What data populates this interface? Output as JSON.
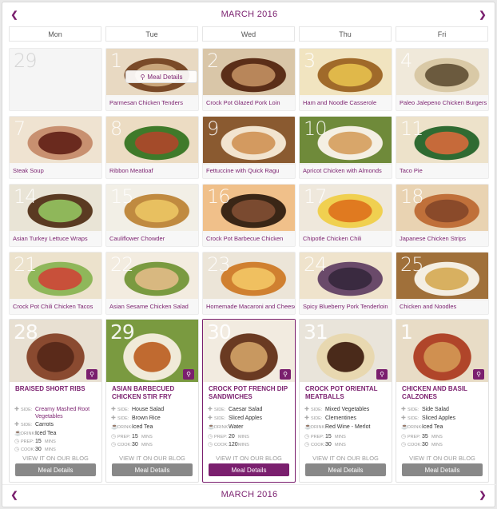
{
  "calendar": {
    "month": "MARCH 2016",
    "prev_icon": "chevron-left-icon",
    "next_icon": "chevron-right-icon",
    "weekdays": [
      "Mon",
      "Tue",
      "Wed",
      "Thu",
      "Fri"
    ]
  },
  "grid": [
    [
      {
        "day": "29",
        "title": "",
        "empty": true
      },
      {
        "day": "1",
        "title": "Parmesan Chicken Tenders",
        "popup": "Meal Details"
      },
      {
        "day": "2",
        "title": "Crock Pot Glazed Pork Loin"
      },
      {
        "day": "3",
        "title": "Ham and Noodle Casserole"
      },
      {
        "day": "4",
        "title": "Paleo Jalepeno Chicken Burgers"
      }
    ],
    [
      {
        "day": "7",
        "title": "Steak Soup"
      },
      {
        "day": "8",
        "title": "Ribbon Meatloaf"
      },
      {
        "day": "9",
        "title": "Fettuccine with Quick Ragu"
      },
      {
        "day": "10",
        "title": "Apricot Chicken with Almonds"
      },
      {
        "day": "11",
        "title": "Taco Pie"
      }
    ],
    [
      {
        "day": "14",
        "title": "Asian Turkey Lettuce Wraps"
      },
      {
        "day": "15",
        "title": "Cauliflower Chowder"
      },
      {
        "day": "16",
        "title": "Crock Pot Barbecue Chicken"
      },
      {
        "day": "17",
        "title": "Chipotle Chicken Chili"
      },
      {
        "day": "18",
        "title": "Japanese Chicken Strips"
      }
    ],
    [
      {
        "day": "21",
        "title": "Crock Pot Chili Chicken Tacos"
      },
      {
        "day": "22",
        "title": "Asian Sesame Chicken Salad"
      },
      {
        "day": "23",
        "title": "Homemade Macaroni and Cheese"
      },
      {
        "day": "24",
        "title": "Spicy Blueberry Pork Tenderloin"
      },
      {
        "day": "25",
        "title": "Chicken and Noodles"
      }
    ]
  ],
  "cards": [
    {
      "day": "28",
      "title": "BRAISED SHORT RIBS",
      "rows": [
        {
          "key": "SIDE:",
          "value": "Creamy Mashed Root Vegetables",
          "link": true
        },
        {
          "key": "SIDE:",
          "value": "Carrots"
        },
        {
          "key": "DRINK:",
          "value": "Iced Tea"
        }
      ],
      "prep": "15",
      "cook": "30",
      "unit": "MINS"
    },
    {
      "day": "29",
      "title": "ASIAN BARBECUED CHICKEN STIR FRY",
      "rows": [
        {
          "key": "SIDE:",
          "value": "House Salad"
        },
        {
          "key": "SIDE:",
          "value": "Brown Rice"
        },
        {
          "key": "DRINK:",
          "value": "Iced Tea"
        }
      ],
      "prep": "15",
      "cook": "30",
      "unit": "MINS"
    },
    {
      "day": "30",
      "title": "CROCK POT FRENCH DIP SANDWICHES",
      "rows": [
        {
          "key": "SIDE:",
          "value": "Caesar Salad"
        },
        {
          "key": "SIDE:",
          "value": "Sliced Apples"
        },
        {
          "key": "DRINK:",
          "value": "Water"
        }
      ],
      "prep": "20",
      "cook": "120",
      "unit": "MINS",
      "active": true
    },
    {
      "day": "31",
      "title": "CROCK POT ORIENTAL MEATBALLS",
      "rows": [
        {
          "key": "SIDE:",
          "value": "Mixed Vegetables"
        },
        {
          "key": "SIDE:",
          "value": "Clementines"
        },
        {
          "key": "DRINK:",
          "value": "Red Wine - Merlot"
        }
      ],
      "prep": "15",
      "cook": "30",
      "unit": "MINS"
    },
    {
      "day": "1",
      "title": "CHICKEN AND BASIL CALZONES",
      "rows": [
        {
          "key": "SIDE:",
          "value": "Side Salad"
        },
        {
          "key": "SIDE:",
          "value": "Sliced Apples"
        },
        {
          "key": "DRINK:",
          "value": "Iced Tea"
        }
      ],
      "prep": "35",
      "cook": "30",
      "unit": "MINS"
    }
  ],
  "labels": {
    "prep": "PREP:",
    "cook": "COOK:",
    "blog": "VIEW IT ON OUR BLOG",
    "meal_details": "Meal Details",
    "zoom_icon": "magnifier-icon"
  },
  "colors": {
    "accent": "#7a1f6e",
    "button_gray": "#888888"
  }
}
